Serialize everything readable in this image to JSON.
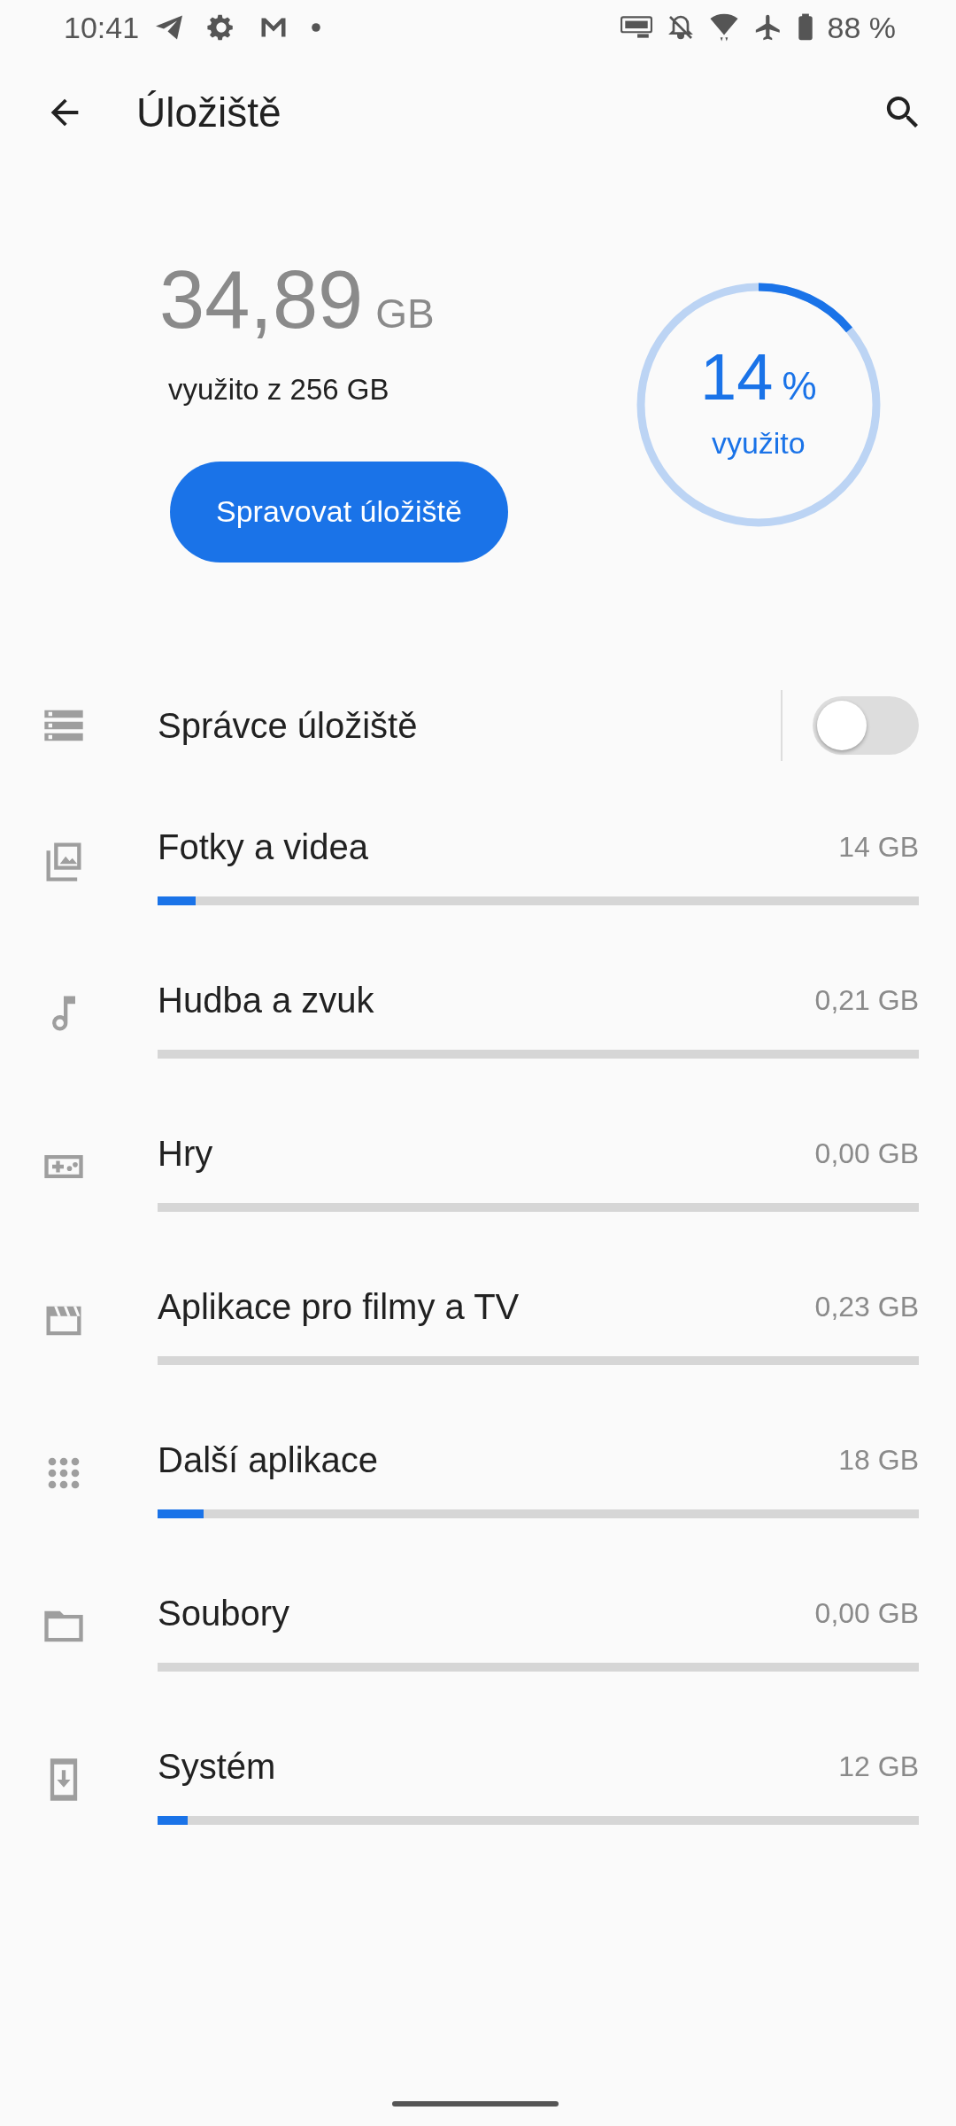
{
  "status_bar": {
    "time": "10:41",
    "battery": "88 %"
  },
  "app_bar": {
    "title": "Úložiště"
  },
  "summary": {
    "used": "34,89",
    "unit": "GB",
    "caption": "využito z 256 GB",
    "button": "Spravovat úložiště",
    "ring": {
      "percent": "14",
      "percent_sign": "%",
      "label": "využito"
    }
  },
  "manager": {
    "label": "Správce úložiště",
    "on": false
  },
  "categories": [
    {
      "kind": "photos",
      "label": "Fotky a videa",
      "size": "14 GB",
      "level": 0.05
    },
    {
      "kind": "music",
      "label": "Hudba a zvuk",
      "size": "0,21 GB",
      "level": 0
    },
    {
      "kind": "games",
      "label": "Hry",
      "size": "0,00 GB",
      "level": 0
    },
    {
      "kind": "movies",
      "label": "Aplikace pro filmy a TV",
      "size": "0,23 GB",
      "level": 0
    },
    {
      "kind": "apps",
      "label": "Další aplikace",
      "size": "18 GB",
      "level": 0.06
    },
    {
      "kind": "files",
      "label": "Soubory",
      "size": "0,00 GB",
      "level": 0
    },
    {
      "kind": "system",
      "label": "Systém",
      "size": "12 GB",
      "level": 0.04
    }
  ]
}
